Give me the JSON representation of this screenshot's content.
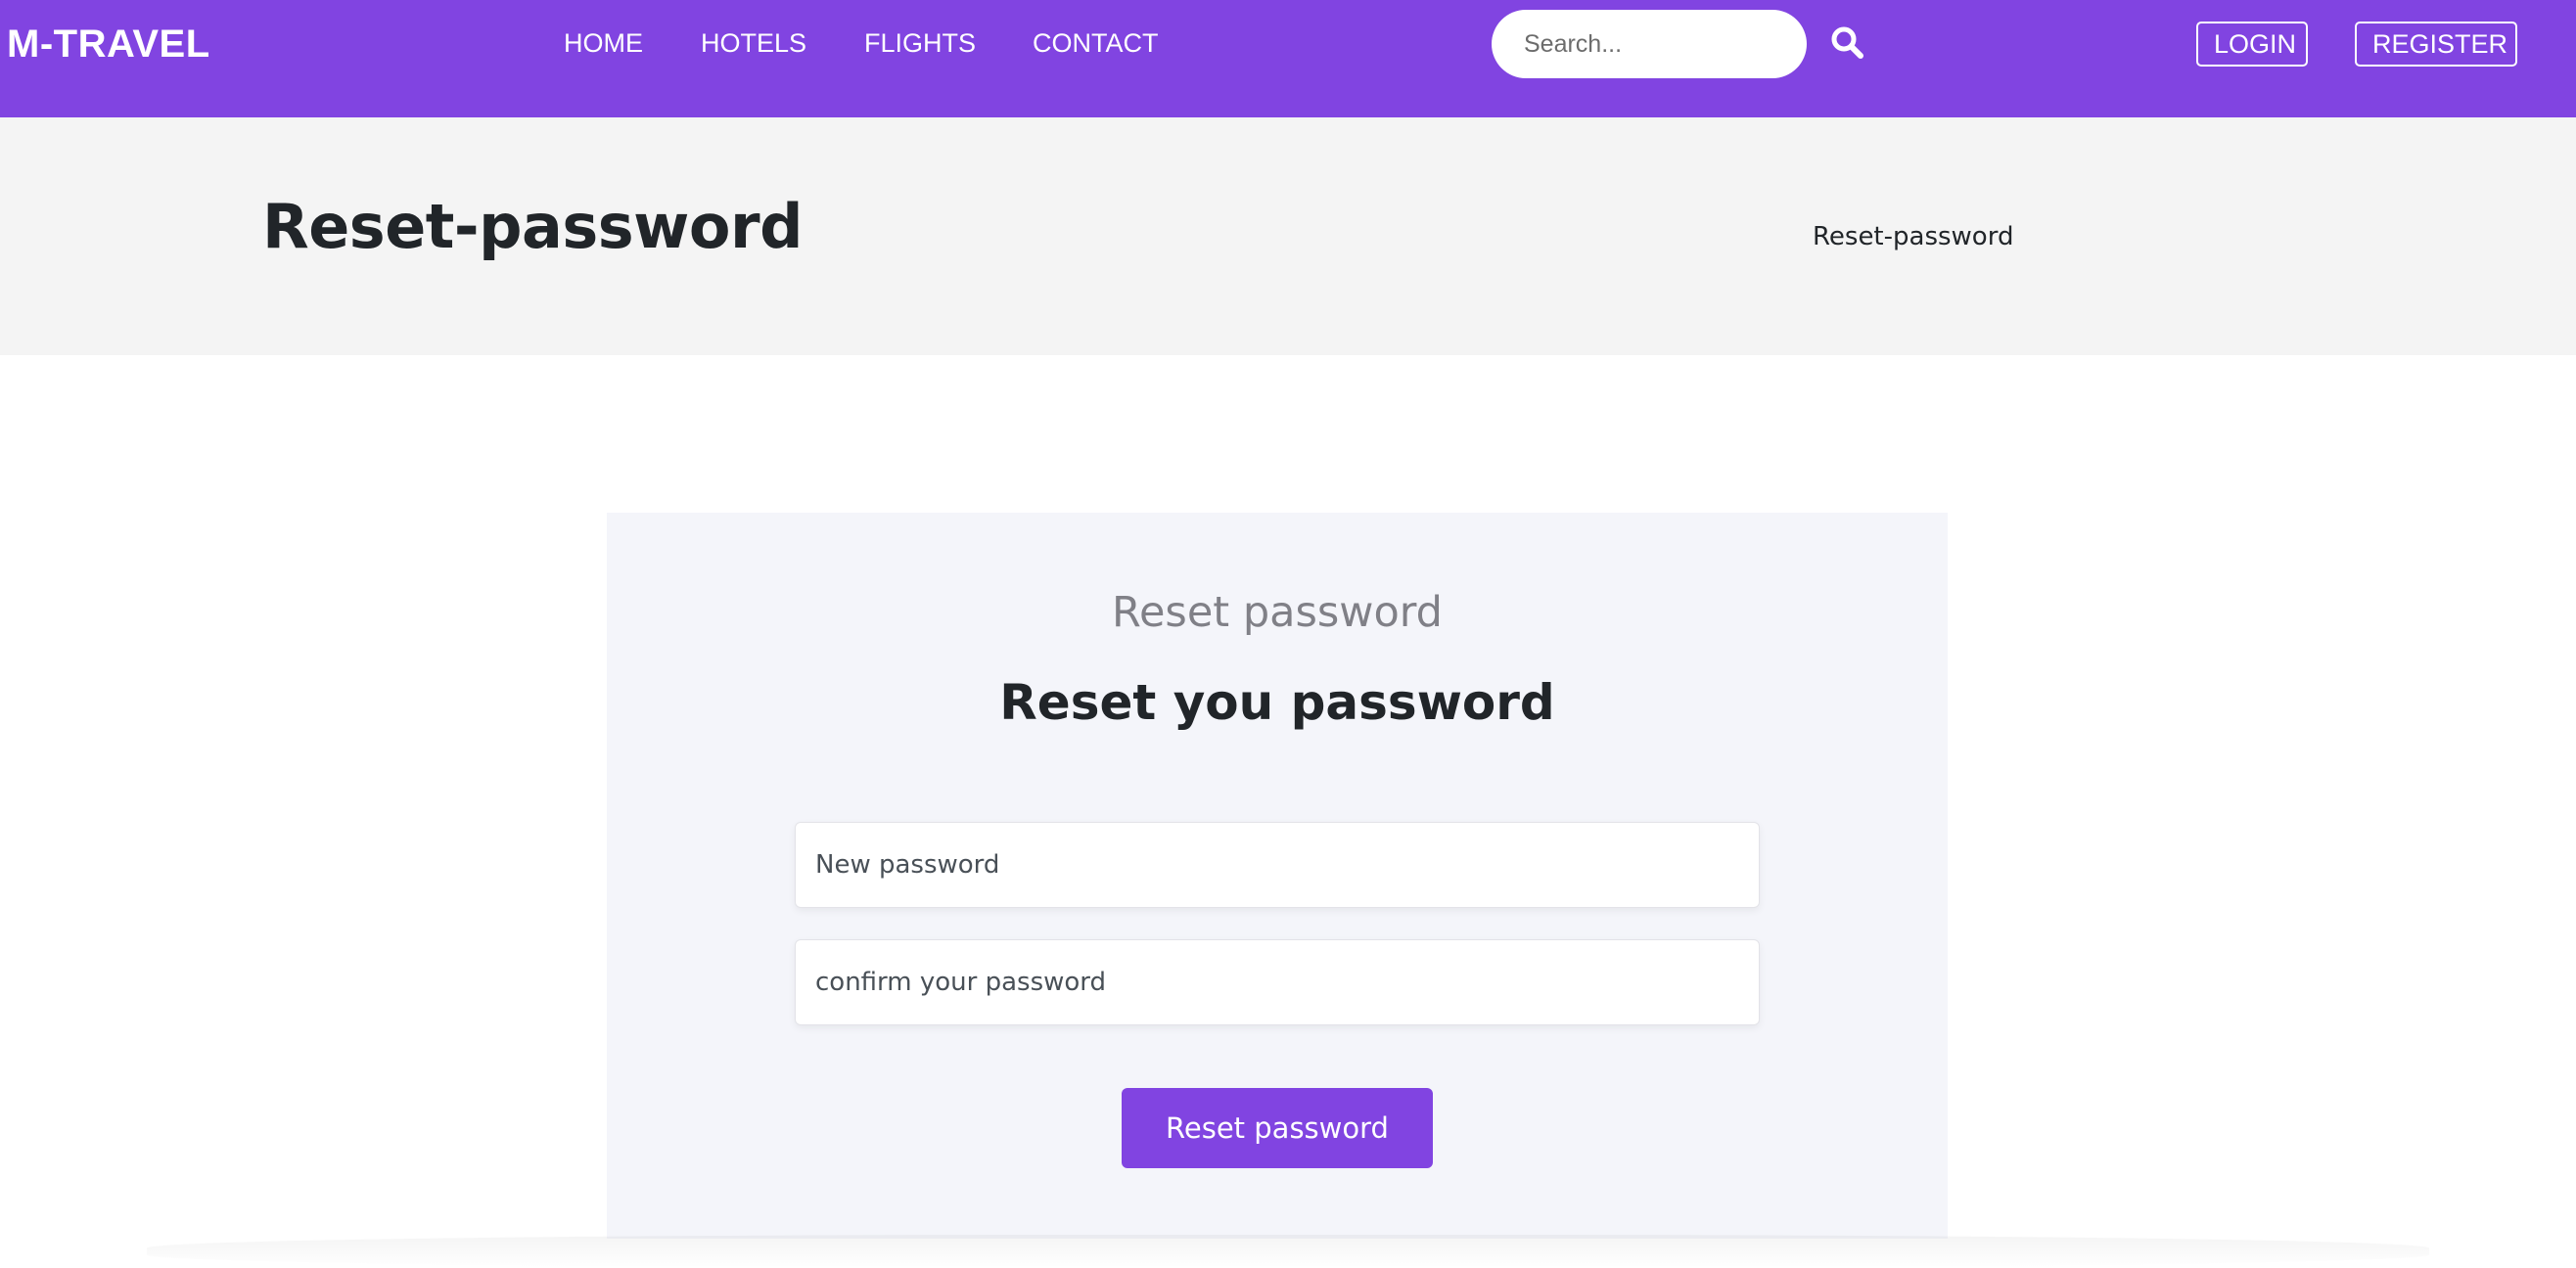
{
  "navbar": {
    "logo": "M-TRAVEL",
    "links": [
      {
        "label": "HOME"
      },
      {
        "label": "HOTELS"
      },
      {
        "label": "FLIGHTS"
      },
      {
        "label": "CONTACT"
      }
    ],
    "search": {
      "placeholder": "Search..."
    },
    "login_label": "LOGIN",
    "register_label": "REGISTER"
  },
  "banner": {
    "title": "Reset-password",
    "breadcrumb": "Reset-password"
  },
  "form": {
    "subtitle": "Reset password",
    "title": "Reset you password",
    "new_password_placeholder": "New password",
    "confirm_password_placeholder": "confirm your password",
    "submit_label": "Reset password"
  },
  "colors": {
    "brand": "#8144e1",
    "banner_bg": "#f4f4f4",
    "card_bg": "#f4f5fa"
  }
}
